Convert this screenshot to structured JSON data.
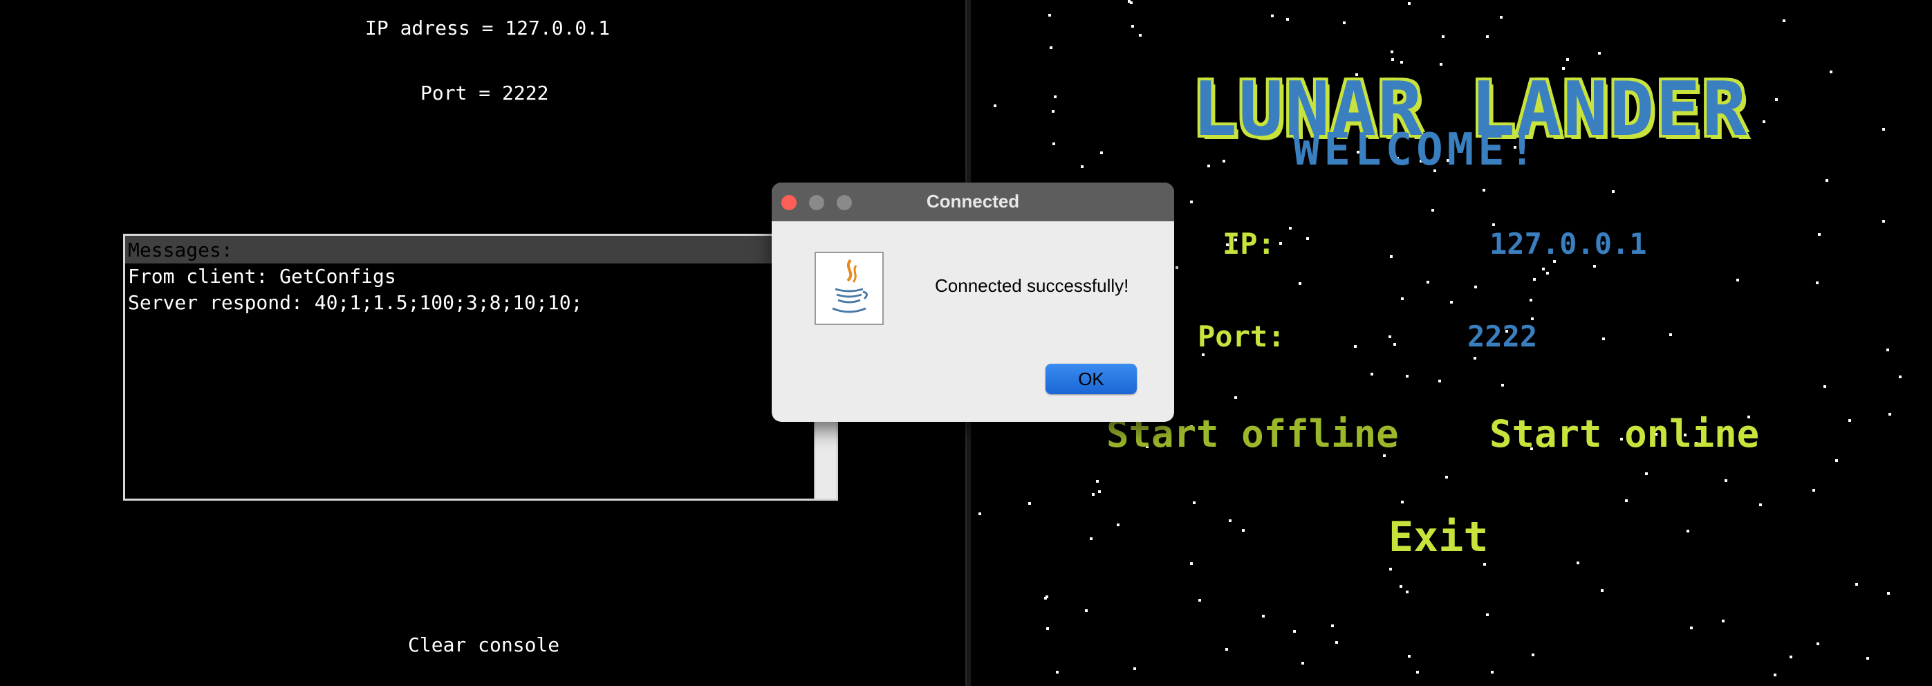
{
  "server": {
    "ip_text": "IP adress = 127.0.0.1",
    "port_text": "Port = 2222",
    "messages_header": "Messages:",
    "messages": [
      "From client: GetConfigs",
      "Server respond: 40;1;1.5;100;3;8;10;10;"
    ],
    "clear_label": "Clear console"
  },
  "game": {
    "title": "LUNAR LANDER",
    "subtitle": "WELCOME!",
    "ip_label": "IP:",
    "ip_value": "127.0.0.1",
    "port_label": "Port:",
    "port_value": "2222",
    "start_offline_label": "Start offline",
    "start_online_label": "Start online",
    "exit_label": "Exit",
    "colors": {
      "blue": "#3a7fbf",
      "yellow_green": "#c8e43c",
      "dim_green": "#9bb82a"
    }
  },
  "dialog": {
    "title": "Connected",
    "icon": "java-icon",
    "message": "Connected successfully!",
    "ok_label": "OK"
  }
}
